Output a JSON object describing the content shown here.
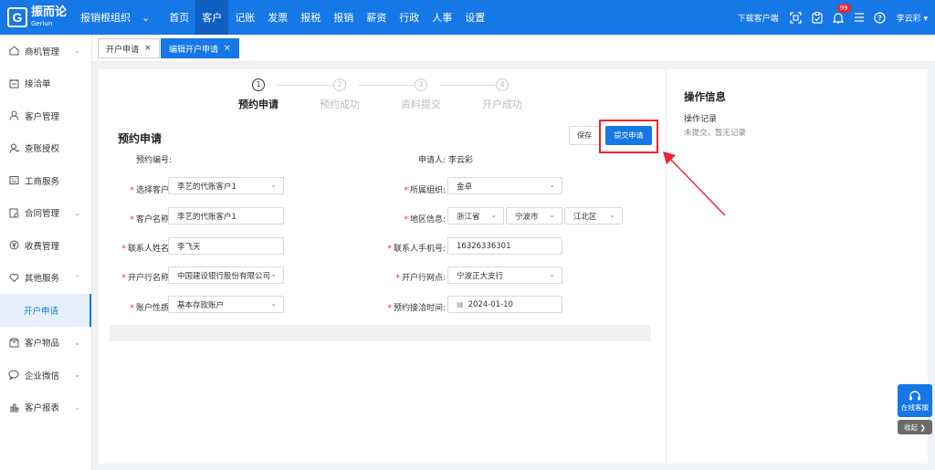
{
  "header": {
    "logo_cn": "振而论",
    "logo_en": "Gerlun",
    "org_label": "报销根组织",
    "nav": [
      "首页",
      "客户",
      "记账",
      "发票",
      "报税",
      "报销",
      "薪资",
      "行政",
      "人事",
      "设置"
    ],
    "active_nav": 1,
    "download_label": "下载客户端",
    "badge_count": "99",
    "user_name": "李云彩"
  },
  "sidebar": {
    "items": [
      {
        "label": "商机管理",
        "icon": "home-icon",
        "arrow": "⌄"
      },
      {
        "label": "接洽单",
        "icon": "contact-icon",
        "arrow": ""
      },
      {
        "label": "客户管理",
        "icon": "user-icon",
        "arrow": ""
      },
      {
        "label": "查账授权",
        "icon": "auth-icon",
        "arrow": ""
      },
      {
        "label": "工商服务",
        "icon": "business-icon",
        "arrow": ""
      },
      {
        "label": "合同管理",
        "icon": "contract-icon",
        "arrow": "⌄"
      },
      {
        "label": "收费管理",
        "icon": "money-icon",
        "arrow": ""
      },
      {
        "label": "其他服务",
        "icon": "heart-icon",
        "arrow": "⌃"
      },
      {
        "label": "开户申请",
        "icon": "",
        "arrow": "",
        "sub": true
      },
      {
        "label": "客户物品",
        "icon": "box-icon",
        "arrow": "⌄"
      },
      {
        "label": "企业微信",
        "icon": "chat-icon",
        "arrow": "⌄"
      },
      {
        "label": "客户报表",
        "icon": "chart-icon",
        "arrow": "⌄"
      }
    ]
  },
  "tabs": [
    {
      "label": "开户申请",
      "close": "×"
    },
    {
      "label": "编辑开户申请",
      "close": "×"
    }
  ],
  "steps": [
    {
      "num": "1",
      "label": "预约申请"
    },
    {
      "num": "2",
      "label": "预约成功"
    },
    {
      "num": "3",
      "label": "资料提交"
    },
    {
      "num": "4",
      "label": "开户成功"
    }
  ],
  "form": {
    "title": "预约申请",
    "save_label": "保存",
    "submit_label": "提交申请",
    "fields": {
      "appointment_no_label": "预约编号:",
      "applicant_label": "申请人:",
      "applicant_value": "李云彩",
      "customer_select_label": "选择客户:",
      "customer_select_value": "李艺的代账客户1",
      "org_label": "所属组织:",
      "org_value": "金卓",
      "customer_name_label": "客户名称:",
      "customer_name_value": "李艺的代账客户1",
      "region_label": "地区信息:",
      "province": "浙江省",
      "city": "宁波市",
      "district": "江北区",
      "contact_name_label": "联系人姓名:",
      "contact_name_value": "李飞天",
      "contact_phone_label": "联系人手机号:",
      "contact_phone_value": "16326336301",
      "bank_name_label": "开户行名称:",
      "bank_name_value": "中国建设银行股份有限公司",
      "bank_branch_label": "开户行网点:",
      "bank_branch_value": "宁波正大支行",
      "account_type_label": "账户性质:",
      "account_type_value": "基本存款账户",
      "appointment_time_label": "预约接洽时间:",
      "appointment_time_value": "2024-01-10"
    }
  },
  "side_panel": {
    "title": "操作信息",
    "record_label": "操作记录",
    "empty_text": "未提交，暂无记录"
  },
  "float": {
    "service_label": "在线客服",
    "collapse_label": "收起"
  },
  "colors": {
    "primary": "#1677e6",
    "highlight": "#f5222d"
  }
}
